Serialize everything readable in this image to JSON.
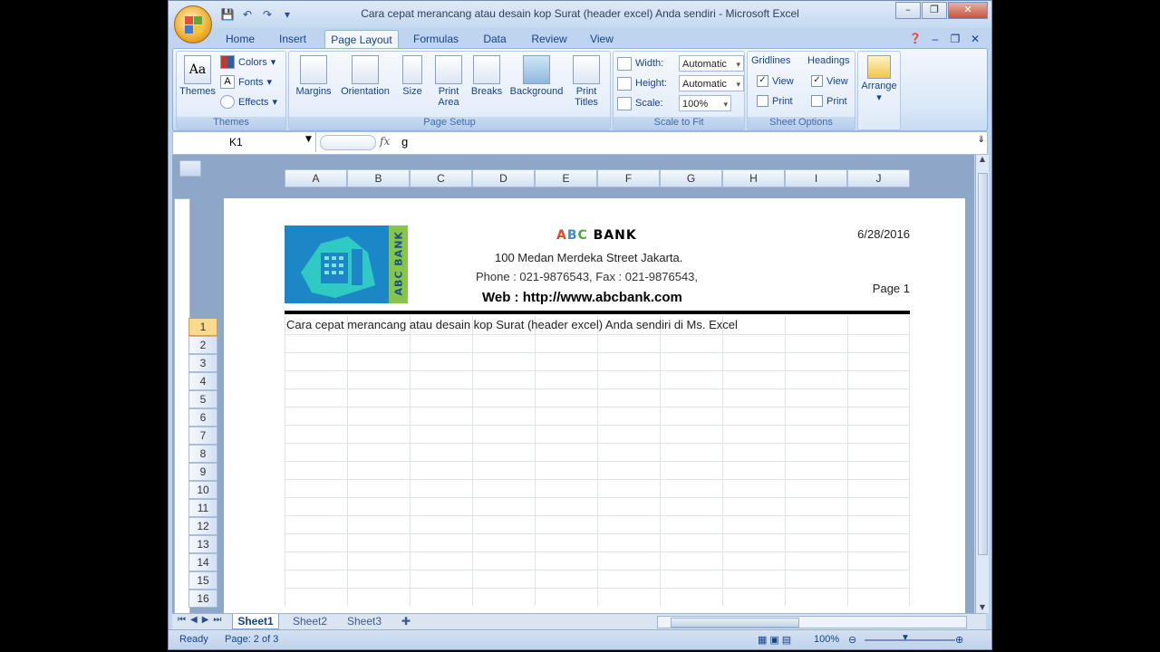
{
  "window": {
    "title": "Cara cepat merancang atau desain kop Surat (header excel) Anda sendiri - Microsoft Excel",
    "minimize_icon": "minimize-icon",
    "maximize_icon": "restore-icon",
    "close_icon": "close-icon"
  },
  "tabs": [
    "Home",
    "Insert",
    "Page Layout",
    "Formulas",
    "Data",
    "Review",
    "View"
  ],
  "active_tab": "Page Layout",
  "ribbon": {
    "themes": {
      "themes_label": "Themes",
      "colors_label": "Colors",
      "fonts_label": "Fonts",
      "effects_label": "Effects",
      "group_label": "Themes"
    },
    "page_setup": {
      "margins": "Margins",
      "orientation": "Orientation",
      "size": "Size",
      "print_area_1": "Print",
      "print_area_2": "Area",
      "breaks": "Breaks",
      "background": "Background",
      "print_titles_1": "Print",
      "print_titles_2": "Titles",
      "group_label": "Page Setup"
    },
    "scale_to_fit": {
      "width_label": "Width:",
      "width_value": "Automatic",
      "height_label": "Height:",
      "height_value": "Automatic",
      "scale_label": "Scale:",
      "scale_value": "100%",
      "group_label": "Scale to Fit"
    },
    "sheet_options": {
      "gridlines": "Gridlines",
      "headings": "Headings",
      "view": "View",
      "print": "Print",
      "group_label": "Sheet Options",
      "gridlines_view_checked": true,
      "gridlines_print_checked": false,
      "headings_view_checked": true,
      "headings_print_checked": false
    },
    "arrange": {
      "label": "Arrange"
    }
  },
  "formula_bar": {
    "name_box": "K1",
    "fx": "fx",
    "value": "g"
  },
  "columns": [
    "A",
    "B",
    "C",
    "D",
    "E",
    "F",
    "G",
    "H",
    "I",
    "J"
  ],
  "rows": [
    "1",
    "2",
    "3",
    "4",
    "5",
    "6",
    "7",
    "8",
    "9",
    "10",
    "11",
    "12",
    "13",
    "14",
    "15",
    "16"
  ],
  "header": {
    "logo_text": "ABC BANK",
    "bank_a": "A",
    "bank_b": "B",
    "bank_c": "C",
    "bank_rest": " BANK",
    "address": "100 Medan Merdeka Street Jakarta.",
    "phone": "Phone : 021-9876543, Fax : 021-9876543,",
    "web": "Web : http://www.abcbank.com",
    "date": "6/28/2016",
    "page": "Page 1"
  },
  "cell_a1": "Cara cepat merancang atau desain kop Surat (header excel) Anda sendiri di Ms. Excel",
  "sheets": [
    "Sheet1",
    "Sheet2",
    "Sheet3"
  ],
  "active_sheet": "Sheet1",
  "status": {
    "ready": "Ready",
    "page": "Page: 2 of 3",
    "zoom": "100%"
  }
}
